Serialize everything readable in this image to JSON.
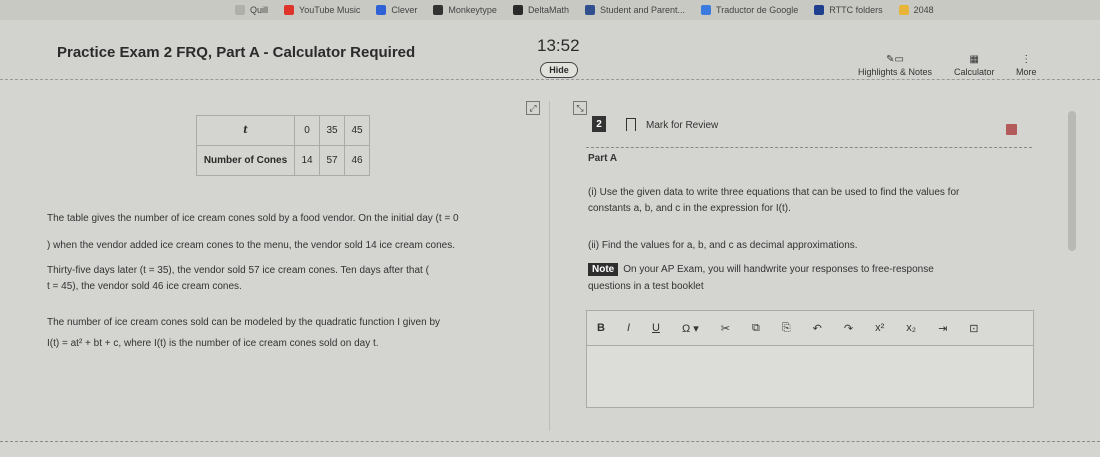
{
  "bookmarks": {
    "items": [
      {
        "label": "Quill",
        "color": "#b0b0aa"
      },
      {
        "label": "YouTube Music",
        "color": "#e0332a"
      },
      {
        "label": "Clever",
        "color": "#2f61d6"
      },
      {
        "label": "Monkeytype",
        "color": "#333333"
      },
      {
        "label": "DeltaMath",
        "color": "#2a2a2a"
      },
      {
        "label": "Student and Parent...",
        "color": "#2f4f8f"
      },
      {
        "label": "Traductor de Google",
        "color": "#3b7be0"
      },
      {
        "label": "RTTC folders",
        "color": "#1f3f8f"
      },
      {
        "label": "2048",
        "color": "#e8b43a"
      }
    ]
  },
  "header": {
    "title": "Practice Exam 2 FRQ, Part A - Calculator Required",
    "timer": "13:52",
    "hide_label": "Hide",
    "tools": [
      {
        "label": "Highlights & Notes",
        "icon": "pencil-note-icon"
      },
      {
        "label": "Calculator",
        "icon": "calculator-icon"
      },
      {
        "label": "More",
        "icon": "more-vertical-icon"
      }
    ]
  },
  "stimulus": {
    "table": {
      "row1_header": "t",
      "row1_values": [
        "0",
        "35",
        "45"
      ],
      "row2_header": "Number of Cones",
      "row2_values": [
        "14",
        "57",
        "46"
      ]
    },
    "lines": [
      "The table gives the number of ice cream cones sold by a food vendor. On the initial day (t = 0",
      ") when the vendor added ice cream cones to the menu, the vendor sold 14 ice cream cones.",
      "Thirty-five days later (t = 35), the vendor sold 57 ice cream cones. Ten days after that (",
      "t = 45), the vendor sold 46 ice cream cones.",
      "The number of ice cream cones sold can be modeled by the quadratic function I given by",
      "I(t) = at² + bt + c, where I(t) is the number of ice cream cones sold on day t."
    ]
  },
  "question": {
    "number": "2",
    "mark_label": "Mark for Review",
    "part": "Part A",
    "line1": "(i) Use the given data to write three equations that can be used to find the values for",
    "line2": "constants a, b, and c in the expression for I(t).",
    "line3": "(ii) Find the values for a, b, and c as decimal approximations.",
    "note_badge": "Note",
    "note_line1": "On your AP Exam, you will handwrite your responses to free-response",
    "note_line2": "questions in a test booklet"
  },
  "editor": {
    "toolbar": [
      "B",
      "I",
      "U",
      "Ω ▾",
      "✂",
      "⧉",
      "⎘",
      "↶",
      "↷",
      "x²",
      "x₂",
      "⇥",
      "⊡"
    ]
  }
}
